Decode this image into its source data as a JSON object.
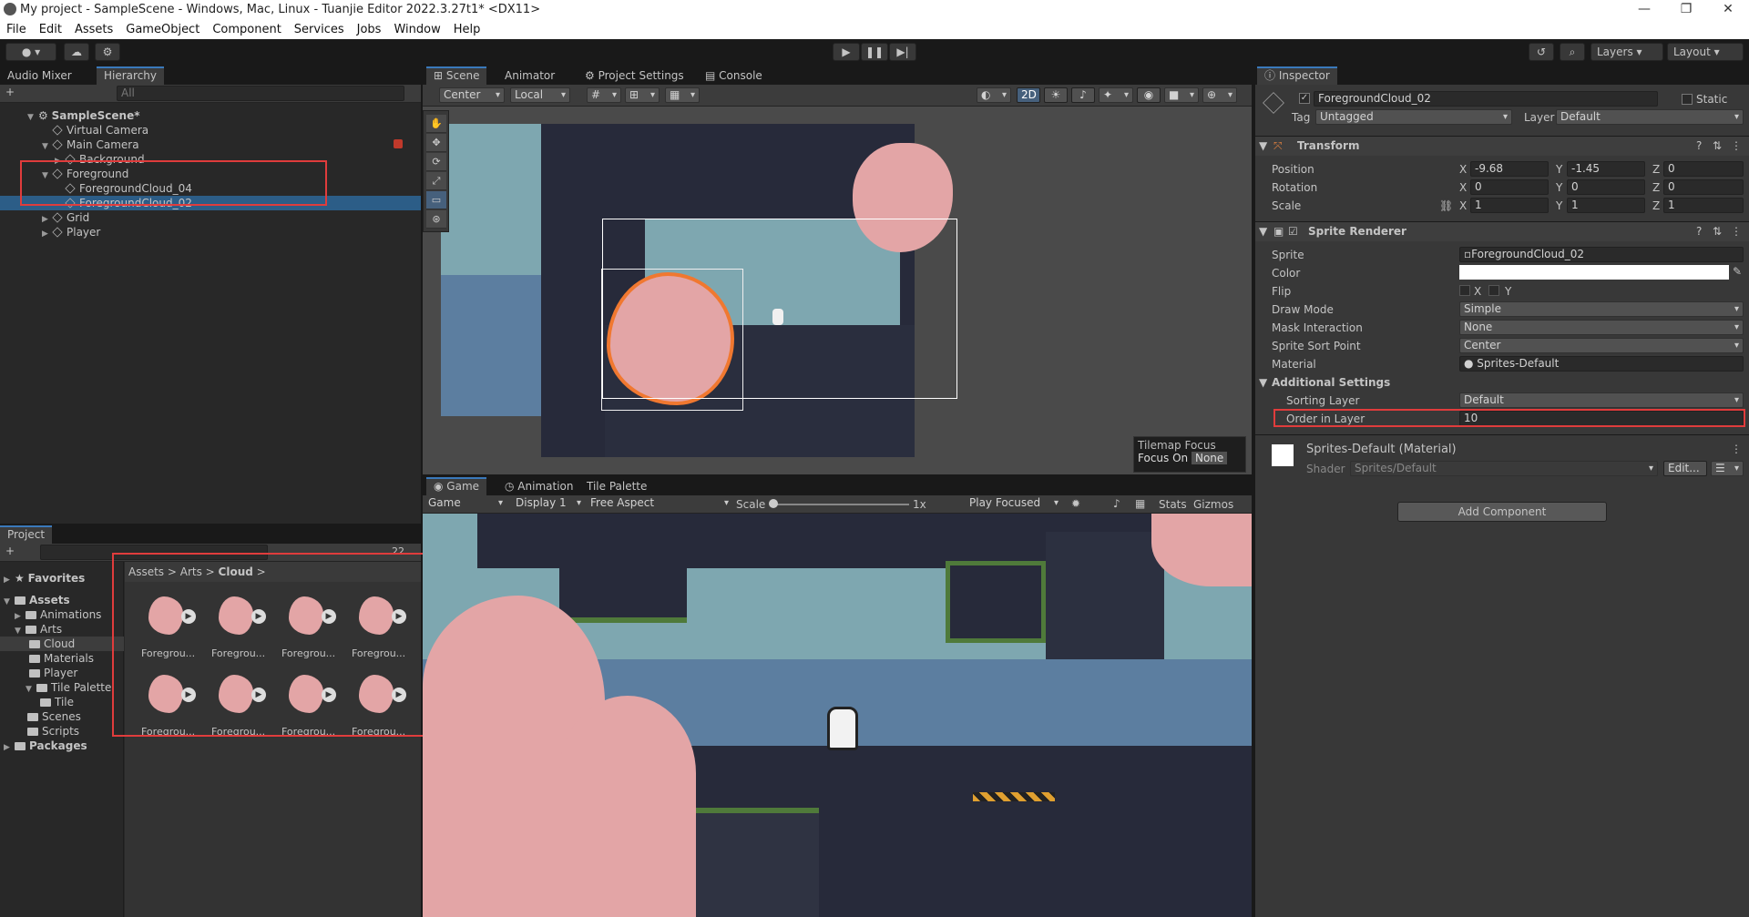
{
  "window": {
    "title": "My project - SampleScene - Windows, Mac, Linux - Tuanjie Editor 2022.3.27t1* <DX11>",
    "minimize": "—",
    "maximize": "❐",
    "close": "✕"
  },
  "menu": [
    "File",
    "Edit",
    "Assets",
    "GameObject",
    "Component",
    "Services",
    "Jobs",
    "Window",
    "Help"
  ],
  "toolbar": {
    "layers": "Layers",
    "layout": "Layout"
  },
  "hierarchy": {
    "tabs": [
      "Audio Mixer",
      "Hierarchy"
    ],
    "search_placeholder": "All",
    "add": "+",
    "scene": "SampleScene*",
    "items": [
      {
        "label": "Virtual Camera",
        "indent": 1
      },
      {
        "label": "Main Camera",
        "indent": 1
      },
      {
        "label": "Background",
        "indent": 2
      },
      {
        "label": "Foreground",
        "indent": 1
      },
      {
        "label": "ForegroundCloud_04",
        "indent": 2
      },
      {
        "label": "ForegroundCloud_02",
        "indent": 2
      },
      {
        "label": "Grid",
        "indent": 1
      },
      {
        "label": "Player",
        "indent": 1
      }
    ]
  },
  "project": {
    "tab": "Project",
    "add": "+",
    "count": "22",
    "favorites": "Favorites",
    "assets": "Assets",
    "tree": [
      "Animations",
      "Arts",
      "Cloud",
      "Materials",
      "Player",
      "Tile Palette",
      "Tile",
      "Scenes",
      "Scripts"
    ],
    "packages": "Packages",
    "breadcrumb": [
      "Assets",
      "Arts",
      "Cloud"
    ],
    "thumbs": [
      "Foregrou...",
      "Foregrou...",
      "Foregrou...",
      "Foregrou...",
      "Foregrou...",
      "Foregrou...",
      "Foregrou...",
      "Foregrou..."
    ]
  },
  "scene": {
    "tabs": [
      "Scene",
      "Animator",
      "Project Settings",
      "Console"
    ],
    "pivot": "Center",
    "space": "Local",
    "mode2d": "2D",
    "tilemap_focus": "Tilemap Focus",
    "focus_on": "Focus On",
    "focus_value": "None"
  },
  "game": {
    "tabs": [
      "Game",
      "Animation",
      "Tile Palette"
    ],
    "mode": "Game",
    "display": "Display 1",
    "aspect": "Free Aspect",
    "scale_label": "Scale",
    "scale_value": "1x",
    "play_focused": "Play Focused",
    "stats": "Stats",
    "gizmos": "Gizmos"
  },
  "inspector": {
    "tab": "Inspector",
    "object_name": "ForegroundCloud_02",
    "static": "Static",
    "tag_label": "Tag",
    "tag": "Untagged",
    "layer_label": "Layer",
    "layer": "Default",
    "transform": {
      "title": "Transform",
      "position": {
        "label": "Position",
        "x": "-9.68",
        "y": "-1.45",
        "z": "0"
      },
      "rotation": {
        "label": "Rotation",
        "x": "0",
        "y": "0",
        "z": "0"
      },
      "scale": {
        "label": "Scale",
        "x": "1",
        "y": "1",
        "z": "1"
      }
    },
    "sprite_renderer": {
      "title": "Sprite Renderer",
      "sprite_label": "Sprite",
      "sprite": "ForegroundCloud_02",
      "color_label": "Color",
      "flip_label": "Flip",
      "flip_x": "X",
      "flip_y": "Y",
      "draw_mode_label": "Draw Mode",
      "draw_mode": "Simple",
      "mask_label": "Mask Interaction",
      "mask": "None",
      "sort_point_label": "Sprite Sort Point",
      "sort_point": "Center",
      "material_label": "Material",
      "material": "Sprites-Default",
      "additional": "Additional Settings",
      "sorting_layer_label": "Sorting Layer",
      "sorting_layer": "Default",
      "order_label": "Order in Layer",
      "order": "10"
    },
    "material_block": {
      "title": "Sprites-Default (Material)",
      "shader_label": "Shader",
      "shader": "Sprites/Default",
      "edit": "Edit..."
    },
    "add_component": "Add Component"
  },
  "colors": {
    "accent": "#3a79bb",
    "highlight": "#e03c3c",
    "cloud": "#e3a5a6",
    "selection": "#2c5d87"
  }
}
